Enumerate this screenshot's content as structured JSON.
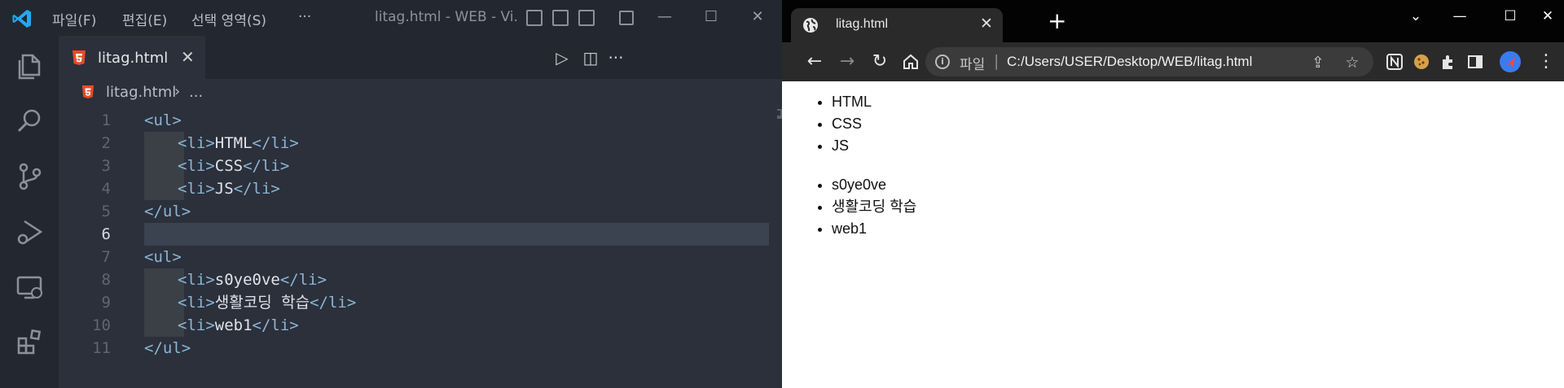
{
  "vscode": {
    "menus": [
      "파일(F)",
      "편집(E)",
      "선택 영역(S)",
      "···"
    ],
    "window_title": "litag.html - WEB - Vi...",
    "tab": {
      "label": "litag.html",
      "close": "✕"
    },
    "breadcrumb": {
      "file": "litag.html",
      "separator": "›",
      "rest": "..."
    },
    "line_numbers": [
      "1",
      "2",
      "3",
      "4",
      "5",
      "6",
      "7",
      "8",
      "9",
      "10",
      "11"
    ],
    "active_line": "6",
    "code": [
      {
        "open": "<ul>",
        "text": "",
        "close": ""
      },
      {
        "open": "<li>",
        "text": "HTML",
        "close": "</li>"
      },
      {
        "open": "<li>",
        "text": "CSS",
        "close": "</li>"
      },
      {
        "open": "<li>",
        "text": "JS",
        "close": "</li>"
      },
      {
        "open": "</ul>",
        "text": "",
        "close": ""
      },
      {
        "open": "",
        "text": "",
        "close": ""
      },
      {
        "open": "<ul>",
        "text": "",
        "close": ""
      },
      {
        "open": "<li>",
        "text": "s0ye0ve",
        "close": "</li>"
      },
      {
        "open": "<li>",
        "text": "생활코딩 학습",
        "close": "</li>"
      },
      {
        "open": "<li>",
        "text": "web1",
        "close": "</li>"
      },
      {
        "open": "</ul>",
        "text": "",
        "close": ""
      }
    ],
    "colors": {
      "tag": "#8ab5d6",
      "html_icon": "#e44d26",
      "logo": "#23a9f2"
    }
  },
  "chrome": {
    "tab": {
      "label": "litag.html",
      "close": "✕"
    },
    "newtab": "+",
    "omnibox": {
      "scheme": "파일",
      "separator": "|",
      "url": "C:/Users/USER/Desktop/WEB/litag.html"
    },
    "page": {
      "list1": [
        "HTML",
        "CSS",
        "JS"
      ],
      "list2": [
        "s0ye0ve",
        "생활코딩 학습",
        "web1"
      ]
    }
  }
}
